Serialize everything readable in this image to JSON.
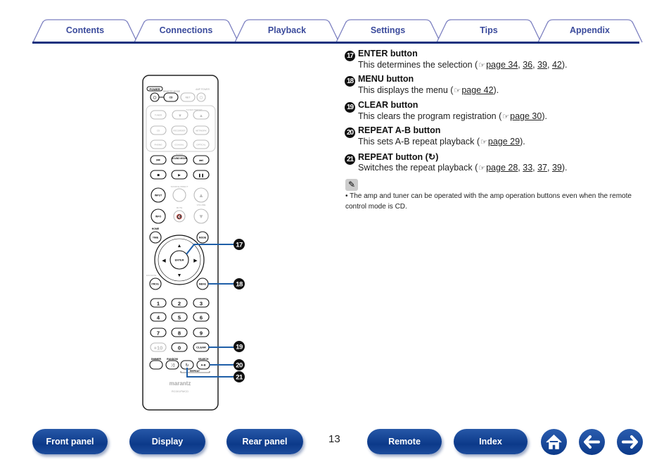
{
  "tabs": [
    "Contents",
    "Connections",
    "Playback",
    "Settings",
    "Tips",
    "Appendix"
  ],
  "items": [
    {
      "num": "17",
      "title": "ENTER button",
      "desc": "This determines the selection (",
      "pages": [
        "page 34",
        "36",
        "39",
        "42"
      ]
    },
    {
      "num": "18",
      "title": "MENU button",
      "desc": "This displays the menu (",
      "pages": [
        "page 42"
      ]
    },
    {
      "num": "19",
      "title": "CLEAR button",
      "desc": "This clears the program registration (",
      "pages": [
        "page 30"
      ]
    },
    {
      "num": "20",
      "title": "REPEAT A-B button",
      "desc": "This sets A-B repeat playback (",
      "pages": [
        "page 29"
      ]
    },
    {
      "num": "21",
      "title": "REPEAT button (",
      "title_icon": "repeat-icon",
      "desc": "Switches the repeat playback (",
      "pages": [
        "page 28",
        "33",
        "37",
        "39"
      ]
    }
  ],
  "note": "The amp and tuner can be operated with the amp operation buttons even when the remote control mode is CD.",
  "page_number": "13",
  "nav": {
    "front_panel": "Front panel",
    "display": "Display",
    "rear_panel": "Rear panel",
    "remote": "Remote",
    "index": "Index"
  },
  "remote": {
    "power": "POWER",
    "remote_mode": "REMOTE MODE",
    "amp_power": "AMP POWER",
    "cd_mode": "CD",
    "net": "NET",
    "tuner_preset": "TUNER PRESET",
    "tuner": "TUNER",
    "cd": "CD",
    "recorder": "RECORDER",
    "network": "NETWORK",
    "phono": "PHONO",
    "coaxial": "COAXIAL",
    "optical": "OPTICAL",
    "mdax": "M-DAX",
    "sound_mode": "SOUND MODE",
    "source_direct": "SOURCE DIRECT",
    "input": "INPUT",
    "mute": "MUTE",
    "volume": "VOLUME",
    "info": "INFO",
    "home": "HOME",
    "time": "TIME",
    "mode": "MODE",
    "enter": "ENTER",
    "favorite": "FAVORITE",
    "prog": "PROG.",
    "menu": "MENU",
    "n1": "1",
    "n2": "2",
    "n3": "3",
    "n4": "4",
    "n5": "5",
    "n6": "6",
    "n7": "7",
    "n8": "8",
    "n9": "9",
    "plus10": "+10",
    "n0": "0",
    "clear": "CLEAR",
    "dimmer": "DIMMER",
    "random": "RANDOM",
    "search": "SEARCH",
    "ab": "A-B",
    "repeat": "REPEAT",
    "brand": "marantz",
    "model": "RC001PMCD"
  },
  "colors": {
    "nav": "#0c3a8a",
    "tab_text": "#3b4b9c",
    "tab_line": "#15317e",
    "callout_line": "#1f5fa8"
  }
}
